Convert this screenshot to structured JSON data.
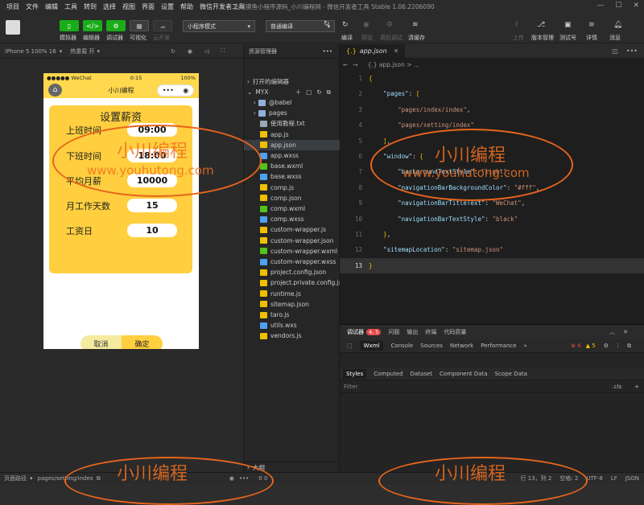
{
  "menubar": {
    "items": [
      "项目",
      "文件",
      "编辑",
      "工具",
      "转到",
      "选择",
      "视图",
      "界面",
      "设置",
      "帮助",
      "微信开发者工具"
    ],
    "window_title": "上班摸鱼小程序源码_小川编程网 - 微信开发者工具 Stable 1.06.2206090"
  },
  "toolbar": {
    "simulator": "模拟器",
    "editor": "编辑器",
    "debugger": "调试器",
    "visual": "可视化",
    "cloud": "云开发",
    "mode_select": "小程序模式",
    "compile_select": "普通编译",
    "compile": "编译",
    "preview": "预览",
    "real_debug": "真机调试",
    "clear_cache": "清缓存",
    "upload": "上传",
    "version": "版本管理",
    "test_account": "测试号",
    "details": "详情",
    "messages": "消息"
  },
  "simulator": {
    "device": "iPhone 5 100% 16",
    "hot_reload": "热重载 开",
    "status_left": "●●●●● WeChat",
    "time": "0:15",
    "battery": "100%",
    "nav_title": "小川编程",
    "card_title": "设置薪资",
    "rows": [
      {
        "label": "上班时间",
        "value": "09:00"
      },
      {
        "label": "下班时间",
        "value": "18:00"
      },
      {
        "label": "平均月薪",
        "value": "10000"
      },
      {
        "label": "月工作天数",
        "value": "15"
      },
      {
        "label": "工资日",
        "value": "10"
      }
    ],
    "cancel": "取消",
    "confirm": "确定"
  },
  "watermark": {
    "text": "小川编程",
    "url": "www.youhutong.com"
  },
  "explorer": {
    "title": "资源管理器",
    "open_editors": "打开的编辑器",
    "root": "MYX",
    "outline": "大纲",
    "items": [
      {
        "name": "@babel",
        "type": "folder"
      },
      {
        "name": "pages",
        "type": "folder"
      },
      {
        "name": "使用教程.txt",
        "type": "txt"
      },
      {
        "name": "app.js",
        "type": "js"
      },
      {
        "name": "app.json",
        "type": "json",
        "selected": true
      },
      {
        "name": "app.wxss",
        "type": "wxss"
      },
      {
        "name": "base.wxml",
        "type": "wxml"
      },
      {
        "name": "base.wxss",
        "type": "wxss"
      },
      {
        "name": "comp.js",
        "type": "js"
      },
      {
        "name": "comp.json",
        "type": "json"
      },
      {
        "name": "comp.wxml",
        "type": "wxml"
      },
      {
        "name": "comp.wxss",
        "type": "wxss"
      },
      {
        "name": "custom-wrapper.js",
        "type": "js"
      },
      {
        "name": "custom-wrapper.json",
        "type": "json"
      },
      {
        "name": "custom-wrapper.wxml",
        "type": "wxml"
      },
      {
        "name": "custom-wrapper.wxss",
        "type": "wxss"
      },
      {
        "name": "project.config.json",
        "type": "json"
      },
      {
        "name": "project.private.config.js...",
        "type": "json"
      },
      {
        "name": "runtime.js",
        "type": "js"
      },
      {
        "name": "sitemap.json",
        "type": "json"
      },
      {
        "name": "taro.js",
        "type": "js"
      },
      {
        "name": "utils.wxs",
        "type": "wxss"
      },
      {
        "name": "vendors.js",
        "type": "js"
      }
    ]
  },
  "editor": {
    "tab": "app.json",
    "breadcrumb": "{.} app.json > ...",
    "lines": [
      {
        "n": "1",
        "parts": [
          [
            "br",
            "{"
          ]
        ]
      },
      {
        "n": "2",
        "parts": [
          [
            "k",
            "    \"pages\""
          ],
          [
            "p",
            ": "
          ],
          [
            "br",
            "["
          ]
        ]
      },
      {
        "n": "3",
        "parts": [
          [
            "s",
            "        \"pages/index/index\""
          ],
          [
            "p",
            ","
          ]
        ]
      },
      {
        "n": "4",
        "parts": [
          [
            "s",
            "        \"pages/setting/index\""
          ]
        ]
      },
      {
        "n": "5",
        "parts": [
          [
            "br",
            "    ]"
          ],
          [
            "p",
            ","
          ]
        ]
      },
      {
        "n": "6",
        "parts": [
          [
            "k",
            "    \"window\""
          ],
          [
            "p",
            ": "
          ],
          [
            "br",
            "{"
          ]
        ]
      },
      {
        "n": "7",
        "parts": [
          [
            "k",
            "        \"backgroundTextStyle\""
          ],
          [
            "p",
            ": "
          ],
          [
            "s",
            "\"light\""
          ],
          [
            "p",
            ","
          ]
        ]
      },
      {
        "n": "8",
        "parts": [
          [
            "k",
            "        \"navigationBarBackgroundColor\""
          ],
          [
            "p",
            ": "
          ],
          [
            "s",
            "\"#fff\""
          ],
          [
            "p",
            ","
          ]
        ]
      },
      {
        "n": "9",
        "parts": [
          [
            "k",
            "        \"navigationBarTitleText\""
          ],
          [
            "p",
            ": "
          ],
          [
            "s",
            "\"WeChat\""
          ],
          [
            "p",
            ","
          ]
        ]
      },
      {
        "n": "10",
        "parts": [
          [
            "k",
            "        \"navigationBarTextStyle\""
          ],
          [
            "p",
            ": "
          ],
          [
            "s",
            "\"black\""
          ]
        ]
      },
      {
        "n": "11",
        "parts": [
          [
            "br",
            "    }"
          ],
          [
            "p",
            ","
          ]
        ]
      },
      {
        "n": "12",
        "parts": [
          [
            "k",
            "    \"sitemapLocation\""
          ],
          [
            "p",
            ": "
          ],
          [
            "s",
            "\"sitemap.json\""
          ]
        ]
      },
      {
        "n": "13",
        "parts": [
          [
            "br",
            "}"
          ]
        ]
      }
    ]
  },
  "devtools": {
    "tabs": [
      "调试器",
      "问题",
      "输出",
      "终端",
      "代码质量"
    ],
    "badge": "4, 5",
    "panels": [
      "Wxml",
      "Console",
      "Sources",
      "Network",
      "Performance"
    ],
    "errors": "4",
    "warnings": "5",
    "sub_tabs": [
      "Styles",
      "Computed",
      "Dataset",
      "Component Data",
      "Scope Data"
    ],
    "filter": "Filter",
    "cls": ".cls"
  },
  "statusbar": {
    "page_path_label": "页面路径",
    "page_path": "pages/setting/index",
    "position": "行 13，列 2",
    "spaces": "空格: 2",
    "encoding": "UTF-8",
    "eol": "LF",
    "lang": "JSON",
    "problems": "0 0"
  }
}
